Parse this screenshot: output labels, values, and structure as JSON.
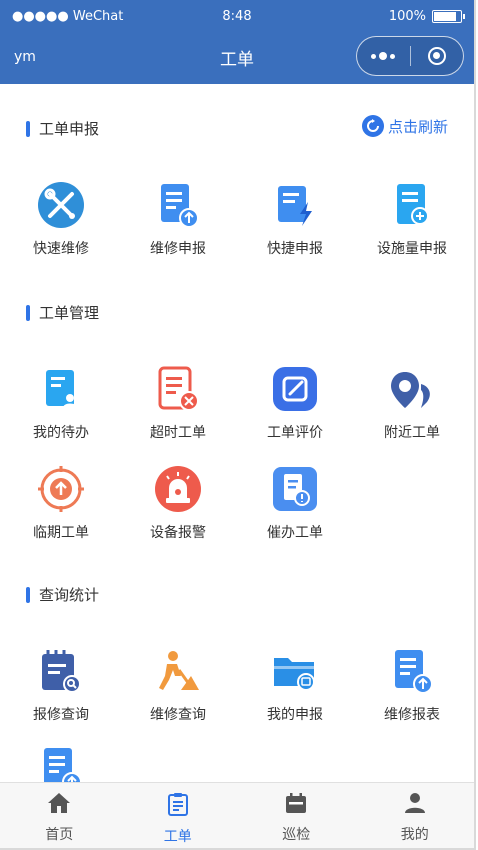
{
  "status_bar": {
    "carrier": "●●●●● WeChat",
    "time": "8:48",
    "battery": "100%"
  },
  "nav": {
    "left_text": "ym",
    "title": "工单"
  },
  "sections": {
    "report": {
      "title": "工单申报",
      "refresh": "点击刷新",
      "items": [
        "快速维修",
        "维修申报",
        "快捷申报",
        "设施量申报"
      ]
    },
    "manage": {
      "title": "工单管理",
      "items": [
        "我的待办",
        "超时工单",
        "工单评价",
        "附近工单",
        "临期工单",
        "设备报警",
        "催办工单"
      ]
    },
    "query": {
      "title": "查询统计",
      "items": [
        "报修查询",
        "维修查询",
        "我的申报",
        "维修报表"
      ]
    }
  },
  "tabbar": {
    "items": [
      "首页",
      "工单",
      "巡检",
      "我的"
    ],
    "active": "工单"
  },
  "colors": {
    "nav": "#3a6fbd",
    "accent": "#2f74e6",
    "red": "#ee5b4c",
    "orange": "#f19a3e"
  }
}
